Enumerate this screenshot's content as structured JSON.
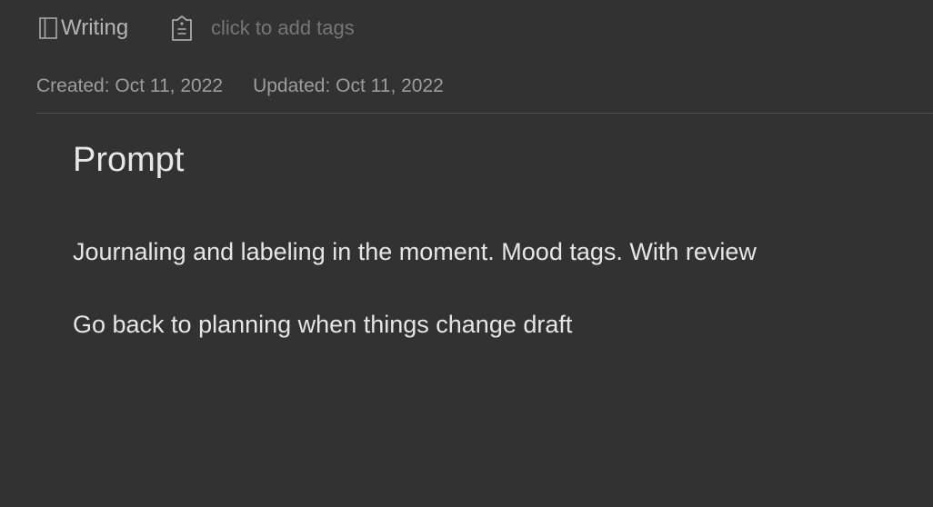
{
  "header": {
    "notebook_icon": "notebook-icon",
    "notebook_name": "Writing",
    "tag_icon": "tag-icon",
    "tags_placeholder": "click to add tags"
  },
  "meta": {
    "created": "Created: Oct 11, 2022",
    "updated": "Updated: Oct 11, 2022"
  },
  "note": {
    "title": "Prompt",
    "paragraphs": [
      "Journaling and labeling in the moment. Mood tags. With review",
      "Go back to planning when things change draft"
    ]
  },
  "colors": {
    "background": "#323232",
    "text": "#e6e6e6",
    "muted_text": "#9d9d9d",
    "placeholder": "#767676",
    "divider": "#4e4e4e"
  }
}
